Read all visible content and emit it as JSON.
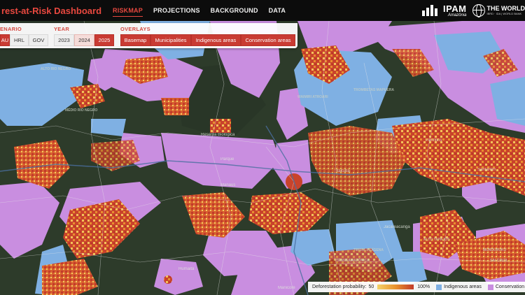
{
  "app": {
    "title": "rest-at-Risk Dashboard"
  },
  "nav": {
    "links": [
      "RISKMAP",
      "PROJECTIONS",
      "BACKGROUND",
      "DATA"
    ],
    "active": "RISKMAP"
  },
  "logos": {
    "ipam_name": "IPAM",
    "ipam_sub": "Amazônia",
    "worldbank_name": "THE WORLD",
    "worldbank_sub": "IBRD · IDA | WORLD BANK"
  },
  "controls": {
    "scenario": {
      "title": "ENARIO",
      "options": [
        "AU",
        "HRL",
        "GOV"
      ],
      "selected": "AU"
    },
    "year": {
      "title": "YEAR",
      "options": [
        "2023",
        "2024",
        "2025"
      ],
      "selected": "2025"
    },
    "overlays": {
      "title": "OVERLAYS",
      "options": [
        "Basemap",
        "Municipalities",
        "Indigenous areas",
        "Conservation areas"
      ]
    }
  },
  "legend": {
    "prob_label": "Deforestation probability:",
    "prob_min": "50",
    "prob_max": "100%",
    "indigenous_label": "Indigenous areas",
    "conservation_label": "Conservation",
    "colors": {
      "indigenous": "#7fb0e3",
      "conservation": "#c98ee0",
      "risk_low": "#f4d26a",
      "risk_mid": "#e9932e",
      "risk_high": "#c23b2a"
    }
  },
  "map_labels": [
    "ALTO RIO NEGRO",
    "MÉDIO RIO NEGRO",
    "Reserva Biológica",
    "WAIMIRI ATROARI",
    "TROMBETAS MAPUERA",
    "Santarém",
    "Parque",
    "Manicoré",
    "ALTO TAPAJÓS",
    "MUNDURUKU",
    "SAI CINZA",
    "Jacareacanga",
    "Parintins",
    "Itaituba",
    "Manaus",
    "Humaitá",
    "TERRA INDÍGENA",
    "TRANSAMAZÔNICA"
  ]
}
